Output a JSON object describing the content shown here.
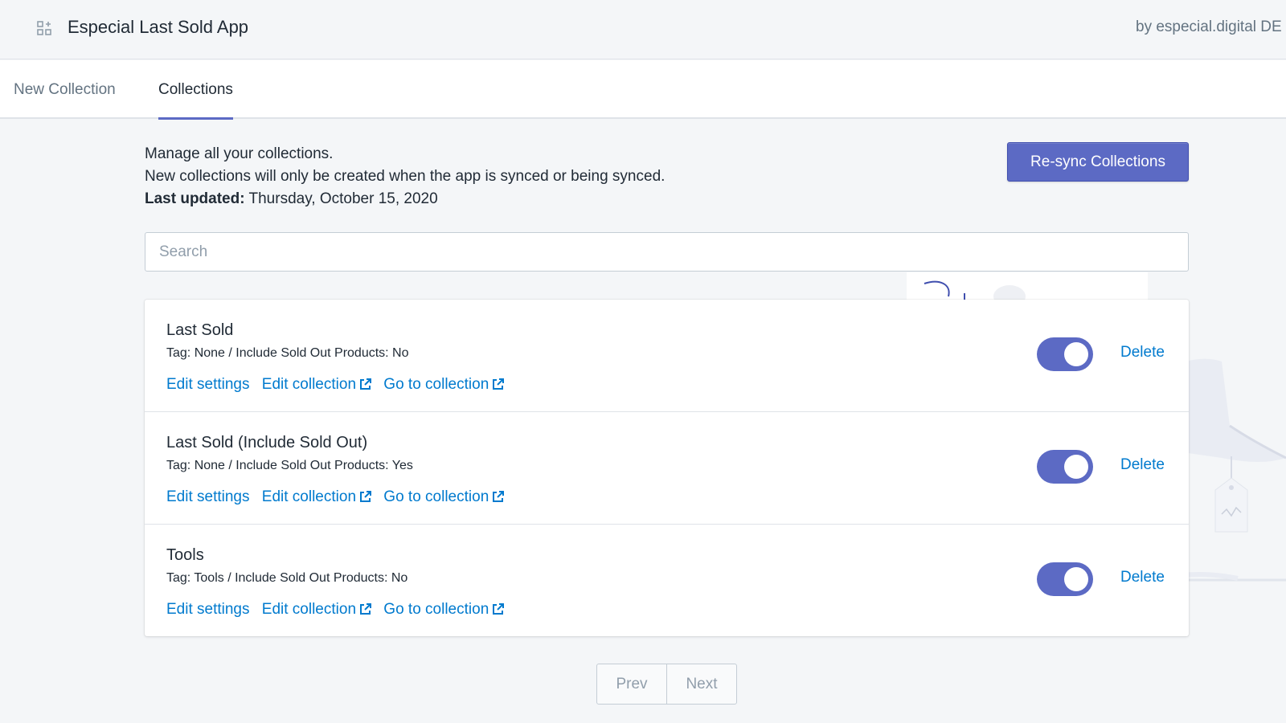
{
  "topbar": {
    "app_icon": "apps-grid-icon",
    "title": "Especial Last Sold App",
    "byline": "by especial.digital DE"
  },
  "tabs": [
    {
      "label": "New Collection",
      "active": false
    },
    {
      "label": "Collections",
      "active": true
    }
  ],
  "intro": {
    "line1": "Manage all your collections.",
    "line2": "New collections will only be created when the app is synced or being synced.",
    "last_updated_label": "Last updated:",
    "last_updated_value": "Thursday, October 15, 2020"
  },
  "resync_label": "Re-sync Collections",
  "search": {
    "placeholder": "Search",
    "value": ""
  },
  "collections": [
    {
      "title": "Last Sold",
      "meta": "Tag: None / Include Sold Out Products: No",
      "edit_settings": "Edit settings",
      "edit_collection": "Edit collection",
      "go_to_collection": "Go to collection",
      "enabled": true,
      "delete_label": "Delete"
    },
    {
      "title": "Last Sold (Include Sold Out)",
      "meta": "Tag: None / Include Sold Out Products: Yes",
      "edit_settings": "Edit settings",
      "edit_collection": "Edit collection",
      "go_to_collection": "Go to collection",
      "enabled": true,
      "delete_label": "Delete"
    },
    {
      "title": "Tools",
      "meta": "Tag: Tools / Include Sold Out Products: No",
      "edit_settings": "Edit settings",
      "edit_collection": "Edit collection",
      "go_to_collection": "Go to collection",
      "enabled": true,
      "delete_label": "Delete"
    }
  ],
  "pagination": {
    "prev_label": "Prev",
    "next_label": "Next"
  },
  "colors": {
    "accent": "#5c6ac4",
    "link": "#007ace",
    "background": "#f4f6f8",
    "text": "#212b36",
    "muted_text": "#637381"
  }
}
